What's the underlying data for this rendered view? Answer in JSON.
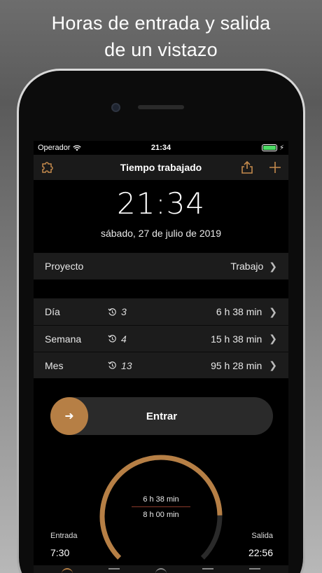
{
  "headline": {
    "line1": "Horas de entrada y salida",
    "line2": "de un vistazo"
  },
  "status": {
    "carrier": "Operador",
    "time": "21:34"
  },
  "nav": {
    "title": "Tiempo trabajado"
  },
  "clock": {
    "time": "21:34",
    "date": "sábado, 27 de julio de 2019"
  },
  "project": {
    "label": "Proyecto",
    "value": "Trabajo"
  },
  "stats": [
    {
      "label": "Día",
      "count": "3",
      "value": "6 h 38 min"
    },
    {
      "label": "Semana",
      "count": "4",
      "value": "15 h 38 min"
    },
    {
      "label": "Mes",
      "count": "13",
      "value": "95 h 28 min"
    }
  ],
  "slider": {
    "label": "Entrar"
  },
  "gauge": {
    "worked": "6 h 38 min",
    "target": "8 h 00 min",
    "progress": 0.83
  },
  "entry": {
    "label": "Entrada",
    "time": "7:30"
  },
  "exit": {
    "label": "Salida",
    "time": "22:56"
  },
  "colors": {
    "accent": "#b67f45",
    "track": "#2a2a2a",
    "row_bg": "#1c1c1c"
  }
}
